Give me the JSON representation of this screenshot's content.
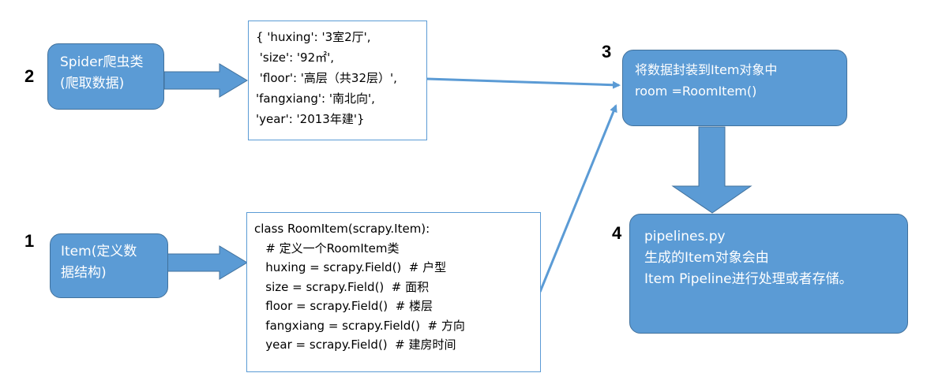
{
  "steps": {
    "step1": "1",
    "step2": "2",
    "step3": "3",
    "step4": "4"
  },
  "spider_box": {
    "line1": "Spider爬虫类",
    "line2": "(爬取数据)"
  },
  "item_box": {
    "line1": "Item(定义数",
    "line2": "据结构)"
  },
  "data_box": {
    "lines": [
      "{ 'huxing': '3室2厅',",
      " 'size': '92㎡',",
      " 'floor': '高层（共32层）',",
      "'fangxiang': '南北向',",
      "'year': '2013年建'}"
    ]
  },
  "code_box": {
    "lines": [
      "class RoomItem(scrapy.Item):",
      "   # 定义一个RoomItem类",
      "   huxing = scrapy.Field()  # 户型",
      "   size = scrapy.Field()  # 面积",
      "   floor = scrapy.Field()  # 楼层",
      "   fangxiang = scrapy.Field()  # 方向",
      "   year = scrapy.Field()  # 建房时间"
    ]
  },
  "encapsulate_box": {
    "line1": "将数据封装到Item对象中",
    "line2": "room =RoomItem()"
  },
  "pipeline_box": {
    "line1": "pipelines.py",
    "line2": "生成的Item对象会由",
    "line3": "Item Pipeline进行处理或者存储。"
  },
  "colors": {
    "box_fill": "#5b9bd5",
    "box_border": "#41719c",
    "text_box_border": "#5b9bd5"
  }
}
